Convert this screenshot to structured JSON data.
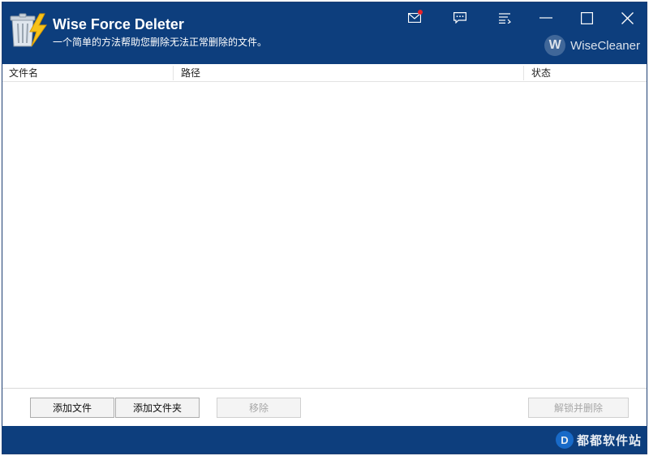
{
  "header": {
    "title": "Wise Force Deleter",
    "subtitle": "一个简单的方法帮助您删除无法正常删除的文件。",
    "brand": "WiseCleaner",
    "brand_badge": "W",
    "icons": [
      "trash-lightning-icon",
      "mail-icon",
      "feedback-icon",
      "menu-icon",
      "minimize-icon",
      "maximize-icon",
      "close-icon"
    ],
    "accent_color": "#0d3e7d",
    "notification_color": "#e8232a"
  },
  "table": {
    "columns": [
      "文件名",
      "路径",
      "状态"
    ],
    "rows": []
  },
  "buttons": {
    "add_file": "添加文件",
    "add_folder": "添加文件夹",
    "remove": "移除",
    "unlock_delete": "解锁并删除"
  },
  "footer": {
    "watermark": "都都软件站",
    "watermark_badge": "D"
  }
}
